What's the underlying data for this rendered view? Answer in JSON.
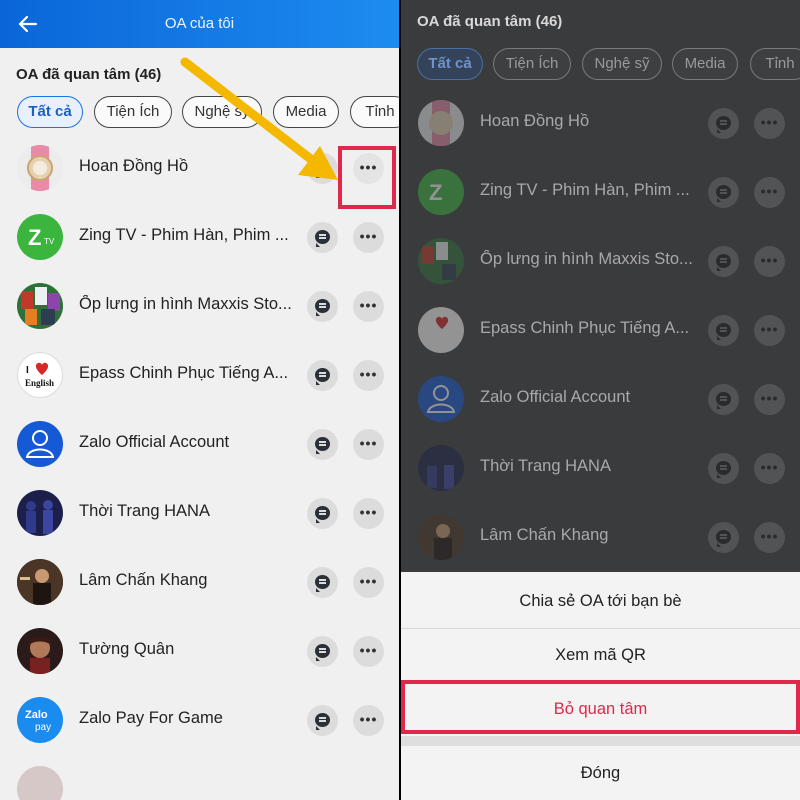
{
  "left": {
    "header_title": "OA của tôi",
    "section_title": "OA đã quan tâm (46)",
    "chips": [
      "Tất cả",
      "Tiện Ích",
      "Nghệ sỹ",
      "Media",
      "Tỉnh"
    ],
    "active_chip": 0,
    "rows": [
      {
        "name": "Hoan Đồng Hồ",
        "avatar": "watch-avatar"
      },
      {
        "name": "Zing TV - Phim Hàn, Phim ...",
        "avatar": "zingtv-avatar"
      },
      {
        "name": "Ốp lưng in hình Maxxis Sto...",
        "avatar": "phone-case-avatar"
      },
      {
        "name": "Epass Chinh Phục Tiếng A...",
        "avatar": "i-love-english-avatar"
      },
      {
        "name": "Zalo Official Account",
        "avatar": "zalo-official-avatar"
      },
      {
        "name": "Thời Trang HANA",
        "avatar": "hana-fashion-avatar"
      },
      {
        "name": "Lâm Chấn Khang",
        "avatar": "person-avatar"
      },
      {
        "name": "Tường Quân",
        "avatar": "portrait-avatar"
      },
      {
        "name": "Zalo Pay For Game",
        "avatar": "zalopay-avatar"
      },
      {
        "name": "",
        "avatar": "partial-avatar"
      }
    ]
  },
  "right": {
    "section_title": "OA đã quan tâm (46)",
    "chips": [
      "Tất cả",
      "Tiện Ích",
      "Nghệ sỹ",
      "Media",
      "Tỉnh"
    ],
    "active_chip": 0,
    "rows": [
      {
        "name": "Hoan Đồng Hồ"
      },
      {
        "name": "Zing TV - Phim Hàn, Phim ..."
      },
      {
        "name": "Ốp lưng in hình Maxxis Sto..."
      },
      {
        "name": "Epass Chinh Phục Tiếng A..."
      },
      {
        "name": "Zalo Official Account"
      },
      {
        "name": "Thời Trang HANA"
      },
      {
        "name": "Lâm Chấn Khang"
      }
    ],
    "sheet": {
      "share": "Chia sẻ OA tới bạn bè",
      "qr": "Xem mã QR",
      "unfollow": "Bỏ quan tâm",
      "close": "Đóng"
    }
  },
  "colors": {
    "accent": "#1a73e8",
    "header_start": "#0a66d8",
    "header_end": "#1d8cf0",
    "highlight": "#e0284a",
    "arrow": "#f5b800"
  },
  "icons": {
    "back": "arrow-left-icon",
    "chat": "chat-bubble-icon",
    "more": "more-dots-icon",
    "annotation": "yellow-arrow-icon"
  }
}
